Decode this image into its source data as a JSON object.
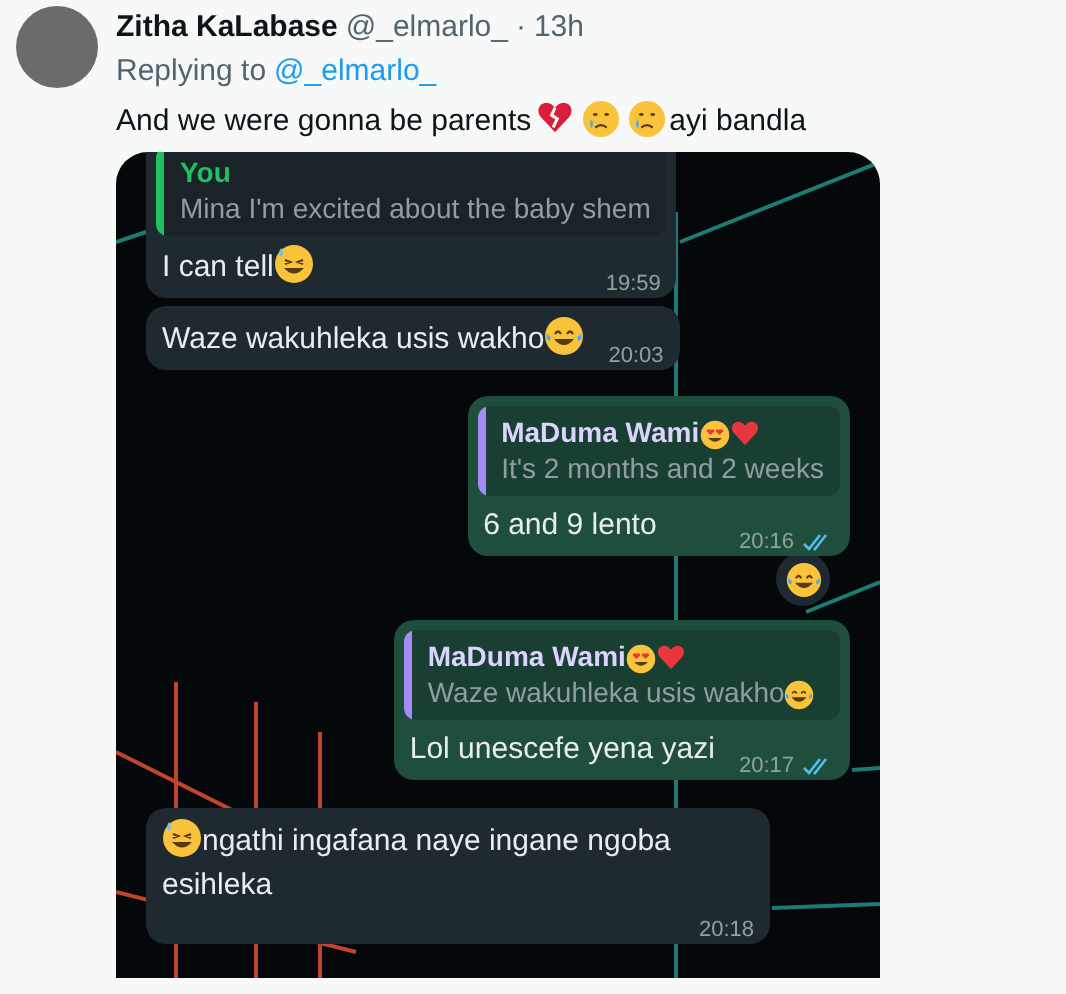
{
  "tweet": {
    "author": "Zitha KaLabase",
    "handle": "@_elmarlo_",
    "separator": "·",
    "time": "13h",
    "replying_label": "Replying to",
    "replying_handle": "@_elmarlo_",
    "parts": [
      {
        "kind": "text",
        "text": "And we were gonna be parents"
      },
      {
        "kind": "broken"
      },
      {
        "kind": "cry"
      },
      {
        "kind": "cry"
      },
      {
        "kind": "text",
        "text": "ayi bandla"
      }
    ]
  },
  "chat": {
    "messages": [
      {
        "kind": "incoming",
        "quote": {
          "author": "You",
          "color": "#21c063",
          "parts": [
            {
              "kind": "text",
              "text": "Mina I'm excited about the baby shem"
            }
          ]
        },
        "parts": [
          {
            "kind": "text",
            "text": "I can tell"
          },
          {
            "kind": "sweat"
          }
        ],
        "time": "19:59"
      },
      {
        "kind": "incoming",
        "parts": [
          {
            "kind": "text",
            "text": "Waze wakuhleka usis wakho"
          },
          {
            "kind": "joy"
          }
        ],
        "time": "20:03"
      },
      {
        "kind": "outgoing",
        "quote": {
          "author": "MaDuma Wami",
          "author_parts": [
            {
              "kind": "hearteyes"
            },
            {
              "kind": "heart"
            }
          ],
          "color": "#a58cf5",
          "parts": [
            {
              "kind": "text",
              "text": "It's 2 months and 2 weeks"
            }
          ]
        },
        "parts": [
          {
            "kind": "text",
            "text": "6 and 9 lento"
          }
        ],
        "time": "20:16",
        "read": true,
        "reaction": {
          "kind": "joy"
        }
      },
      {
        "kind": "outgoing",
        "quote": {
          "author": "MaDuma Wami",
          "author_parts": [
            {
              "kind": "hearteyes"
            },
            {
              "kind": "heart"
            }
          ],
          "color": "#a58cf5",
          "parts": [
            {
              "kind": "text",
              "text": "Waze wakuhleka usis wakho"
            },
            {
              "kind": "joy"
            }
          ]
        },
        "parts": [
          {
            "kind": "text",
            "text": "Lol unescefe yena yazi"
          }
        ],
        "time": "20:17",
        "read": true
      },
      {
        "kind": "incoming",
        "parts": [
          {
            "kind": "sweat"
          },
          {
            "kind": "text",
            "text": "ngathi ingafana naye ingane ngoba esihleka"
          }
        ],
        "time": "20:18"
      }
    ]
  }
}
